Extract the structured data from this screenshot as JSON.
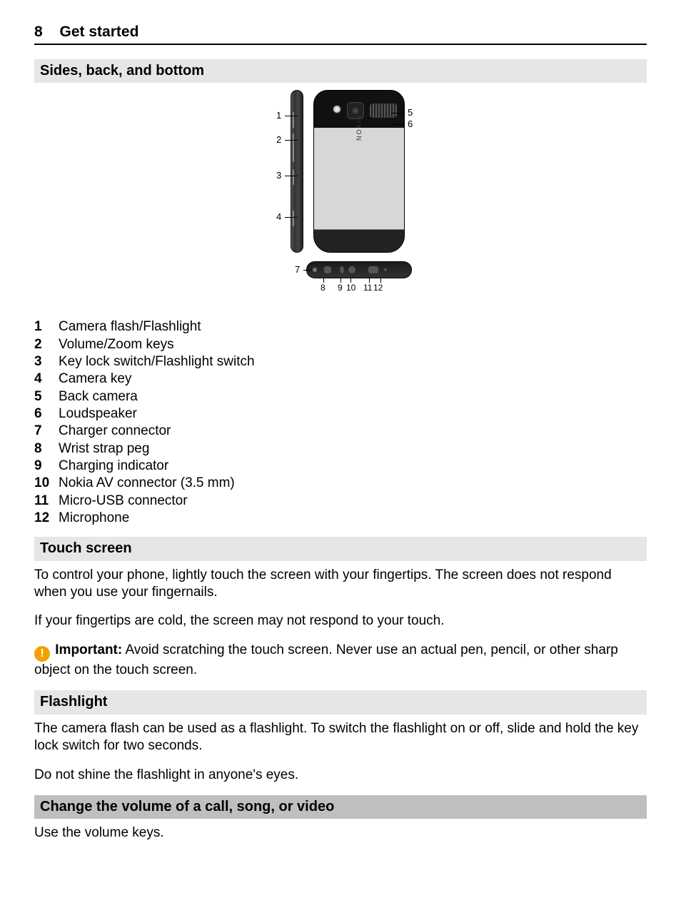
{
  "header": {
    "page_number": "8",
    "chapter": "Get started"
  },
  "sections": {
    "sides": {
      "title": "Sides, back, and bottom",
      "diagram": {
        "brand": "NOKIA",
        "labels": {
          "1": "1",
          "2": "2",
          "3": "3",
          "4": "4",
          "5": "5",
          "6": "6",
          "7": "7",
          "8": "8",
          "9": "9",
          "10": "10",
          "11": "11",
          "12": "12"
        }
      },
      "parts": [
        {
          "n": "1",
          "text": "Camera flash/Flashlight"
        },
        {
          "n": "2",
          "text": "Volume/Zoom keys"
        },
        {
          "n": "3",
          "text": "Key lock switch/Flashlight switch"
        },
        {
          "n": "4",
          "text": "Camera key"
        },
        {
          "n": "5",
          "text": "Back camera"
        },
        {
          "n": "6",
          "text": "Loudspeaker"
        },
        {
          "n": "7",
          "text": "Charger connector"
        },
        {
          "n": "8",
          "text": "Wrist strap peg"
        },
        {
          "n": "9",
          "text": "Charging indicator"
        },
        {
          "n": "10",
          "text": "Nokia AV connector (3.5 mm)"
        },
        {
          "n": "11",
          "text": "Micro-USB connector"
        },
        {
          "n": "12",
          "text": "Microphone"
        }
      ]
    },
    "touch": {
      "title": "Touch screen",
      "p1": "To control your phone, lightly touch the screen with your fingertips. The screen does not respond when you use your fingernails.",
      "p2": "If your fingertips are cold, the screen may not respond to your touch.",
      "important_label": "Important:",
      "important_text": " Avoid scratching the touch screen. Never use an actual pen, pencil, or other sharp object on the touch screen."
    },
    "flashlight": {
      "title": "Flashlight",
      "p1": "The camera flash can be used as a flashlight. To switch the flashlight on or off, slide and hold the key lock switch for two seconds.",
      "p2": "Do not shine the flashlight in anyone's eyes."
    },
    "volume": {
      "title": "Change the volume of a call, song, or video",
      "p1": "Use the volume keys."
    }
  }
}
